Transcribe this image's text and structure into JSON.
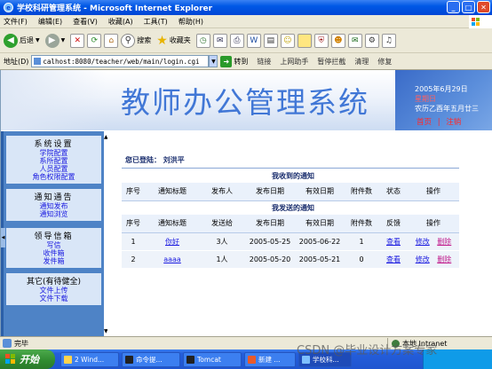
{
  "window": {
    "title": "学校科研管理系统 - Microsoft Internet Explorer"
  },
  "menu": [
    "文件(F)",
    "编辑(E)",
    "查看(V)",
    "收藏(A)",
    "工具(T)",
    "帮助(H)"
  ],
  "toolbar": {
    "back": "后退",
    "search": "搜索",
    "favorites": "收藏夹"
  },
  "address": {
    "label": "地址(D)",
    "url": "calhost:8080/teacher/web/main/login.cgi",
    "go": "转到",
    "links": "链接",
    "helper": "上网助手",
    "popup": "暂停拦截",
    "clean": "清理",
    "repair": "修复"
  },
  "banner": {
    "system_title": "教师办公管理系统",
    "date": "2005年6月29日",
    "weekday": "星期日",
    "lunar": "农历乙酉年五月廿三",
    "home": "首页",
    "divider": "|",
    "logout": "注销"
  },
  "sidebar": {
    "groups": [
      {
        "title": "系统设置",
        "items": [
          "学院配置",
          "系所配置",
          "人员配置",
          "角色权限配置"
        ]
      },
      {
        "title": "通知通告",
        "items": [
          "通知发布",
          "通知浏览"
        ]
      },
      {
        "title": "领导信箱",
        "items": [
          "写信",
          "收件箱",
          "发件箱"
        ]
      },
      {
        "title": "其它(有待健全)",
        "items": [
          "文件上传",
          "文件下载"
        ]
      }
    ]
  },
  "main": {
    "welcome_label": "您已登陆：",
    "welcome_user": "刘洪平",
    "received": {
      "title": "我收到的通知",
      "headers": [
        "序号",
        "通知标题",
        "发布人",
        "发布日期",
        "有效日期",
        "附件数",
        "状态",
        "操作"
      ]
    },
    "sent": {
      "title": "我发送的通知",
      "headers": [
        "序号",
        "通知标题",
        "发送给",
        "发布日期",
        "有效日期",
        "附件数",
        "反馈",
        "操作"
      ],
      "rows": [
        {
          "no": "1",
          "title": "你好",
          "to": "3人",
          "pub": "2005-05-25",
          "valid": "2005-06-22",
          "att": "1",
          "feedback": "查看",
          "edit": "修改",
          "del": "删除"
        },
        {
          "no": "2",
          "title": "aaaa",
          "to": "1人",
          "pub": "2005-05-20",
          "valid": "2005-05-21",
          "att": "0",
          "feedback": "查看",
          "edit": "修改",
          "del": "删除"
        }
      ]
    }
  },
  "status": {
    "text": "完毕",
    "zone": "本地 Intranet"
  },
  "taskbar": {
    "start": "开始",
    "items": [
      "2 Wind...",
      "命令提...",
      "Tomcat",
      "新建 ...",
      "学校科..."
    ]
  },
  "watermark": "CSDN @毕业设计方案专家",
  "colors": {
    "accent": "#4177d6",
    "sidebar": "#4e83c6",
    "link": "#1a1ae0",
    "delete": "#c01a8c"
  }
}
